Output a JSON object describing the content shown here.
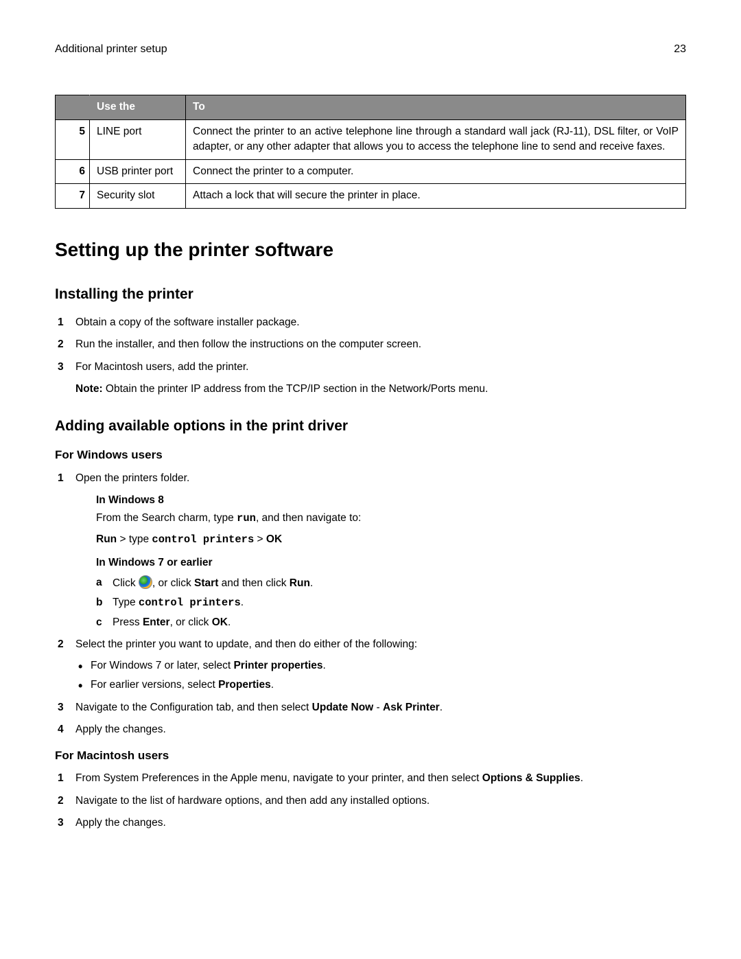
{
  "header": {
    "title": "Additional printer setup",
    "page_number": "23"
  },
  "table": {
    "headers": {
      "blank": "",
      "use": "Use the",
      "to": "To"
    },
    "rows": [
      {
        "num": "5",
        "use": "LINE port",
        "to": "Connect the printer to an active telephone line through a standard wall jack (RJ-11), DSL filter, or VoIP adapter, or any other adapter that allows you to access the telephone line to send and receive faxes."
      },
      {
        "num": "6",
        "use": "USB printer port",
        "to": "Connect the printer to a computer."
      },
      {
        "num": "7",
        "use": "Security slot",
        "to": "Attach a lock that will secure the printer in place."
      }
    ]
  },
  "h1": "Setting up the printer software",
  "section_install": {
    "heading": "Installing the printer",
    "steps": [
      "Obtain a copy of the software installer package.",
      "Run the installer, and then follow the instructions on the computer screen.",
      "For Macintosh users, add the printer."
    ],
    "note_label": "Note:",
    "note_text": " Obtain the printer IP address from the TCP/IP section in the Network/Ports menu."
  },
  "section_options": {
    "heading": "Adding available options in the print driver",
    "windows": {
      "heading": "For Windows users",
      "step1": "Open the printers folder.",
      "win8": {
        "heading": "In Windows 8",
        "line_pre": "From the Search charm, type ",
        "run_cmd": "run",
        "line_post": ", and then navigate to:",
        "runline_run": "Run",
        "runline_gt1": " > ",
        "runline_type": "type ",
        "runline_cmd": "control printers",
        "runline_gt2": " > ",
        "runline_ok": "OK"
      },
      "win7": {
        "heading": "In Windows 7 or earlier",
        "a_pre": "Click ",
        "a_mid": ", or click ",
        "a_start": "Start",
        "a_mid2": " and then click ",
        "a_run": "Run",
        "a_post": ".",
        "b_pre": "Type ",
        "b_cmd": "control printers",
        "b_post": ".",
        "c_pre": "Press ",
        "c_enter": "Enter",
        "c_mid": ", or click ",
        "c_ok": "OK",
        "c_post": "."
      },
      "step2": "Select the printer you want to update, and then do either of the following:",
      "bullets": {
        "b1_pre": "For Windows 7 or later, select ",
        "b1_bold": "Printer properties",
        "b1_post": ".",
        "b2_pre": "For earlier versions, select ",
        "b2_bold": "Properties",
        "b2_post": "."
      },
      "step3_pre": "Navigate to the Configuration tab, and then select ",
      "step3_update": "Update Now",
      "step3_dash": " ‑ ",
      "step3_ask": "Ask Printer",
      "step3_post": ".",
      "step4": "Apply the changes."
    },
    "mac": {
      "heading": "For Macintosh users",
      "step1_pre": "From System Preferences in the Apple menu, navigate to your printer, and then select ",
      "step1_bold": "Options & Supplies",
      "step1_post": ".",
      "step2": "Navigate to the list of hardware options, and then add any installed options.",
      "step3": "Apply the changes."
    }
  },
  "markers": {
    "n1": "1",
    "n2": "2",
    "n3": "3",
    "n4": "4",
    "a": "a",
    "b": "b",
    "c": "c"
  }
}
